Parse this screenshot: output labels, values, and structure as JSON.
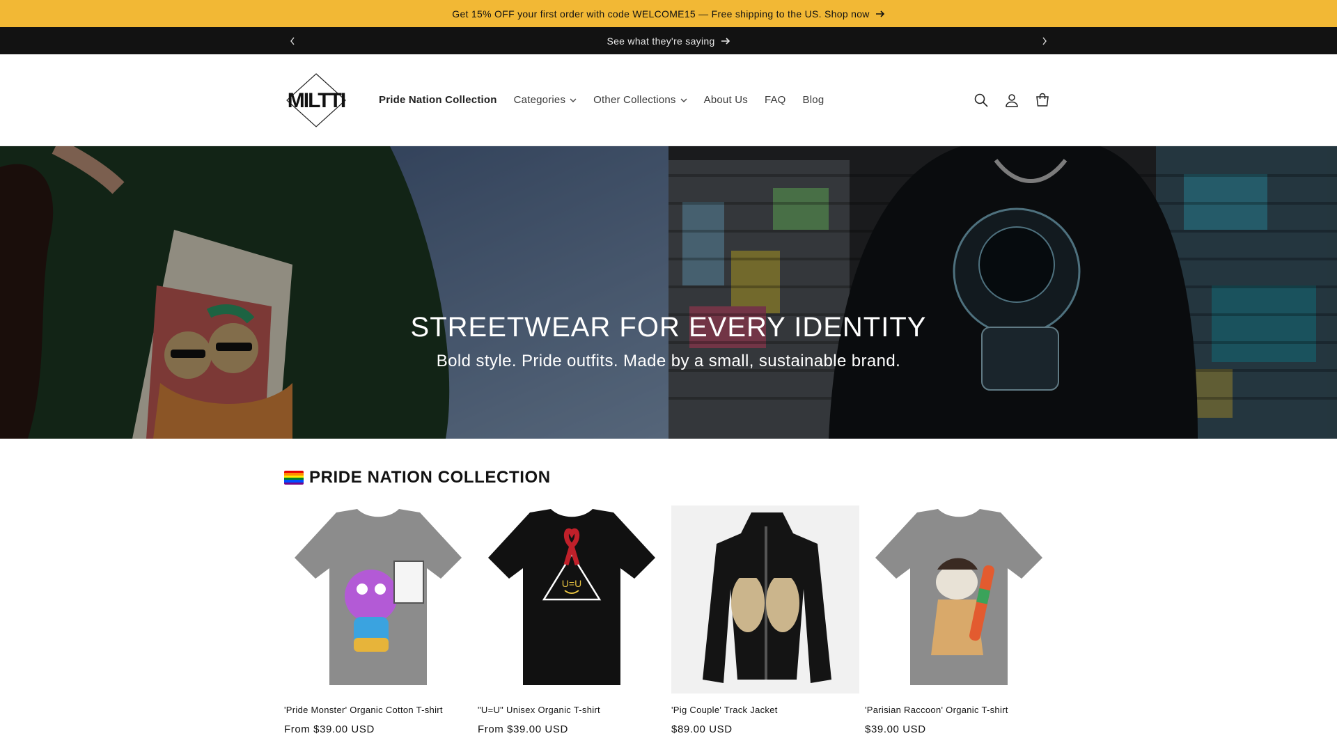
{
  "announcement": {
    "promo_text": "Get 15% OFF your first order with code WELCOME15 — Free shipping to the US. Shop now",
    "testimonial_text": "See what they're saying"
  },
  "header": {
    "logo_text": "MILTTI",
    "nav": [
      {
        "label": "Pride Nation Collection",
        "active": true,
        "dropdown": false
      },
      {
        "label": "Categories",
        "active": false,
        "dropdown": true
      },
      {
        "label": "Other Collections",
        "active": false,
        "dropdown": true
      },
      {
        "label": "About Us",
        "active": false,
        "dropdown": false
      },
      {
        "label": "FAQ",
        "active": false,
        "dropdown": false
      },
      {
        "label": "Blog",
        "active": false,
        "dropdown": false
      }
    ],
    "icons": [
      "search-icon",
      "account-icon",
      "cart-icon"
    ]
  },
  "hero": {
    "title": "STREETWEAR FOR EVERY IDENTITY",
    "subtitle": "Bold style. Pride outfits. Made by a small, sustainable brand."
  },
  "collection": {
    "title": "PRIDE NATION COLLECTION",
    "products": [
      {
        "name": "'Pride Monster' Organic Cotton T-shirt",
        "price": "From $39.00 USD"
      },
      {
        "name": "\"U=U\" Unisex Organic T-shirt",
        "price": "From $39.00 USD"
      },
      {
        "name": "'Pig Couple' Track Jacket",
        "price": "$89.00 USD"
      },
      {
        "name": "'Parisian Raccoon' Organic T-shirt",
        "price": "$39.00 USD"
      }
    ]
  },
  "colors": {
    "promo_bar": "#f2b835",
    "dark_bar": "#121212",
    "text": "#121212"
  }
}
